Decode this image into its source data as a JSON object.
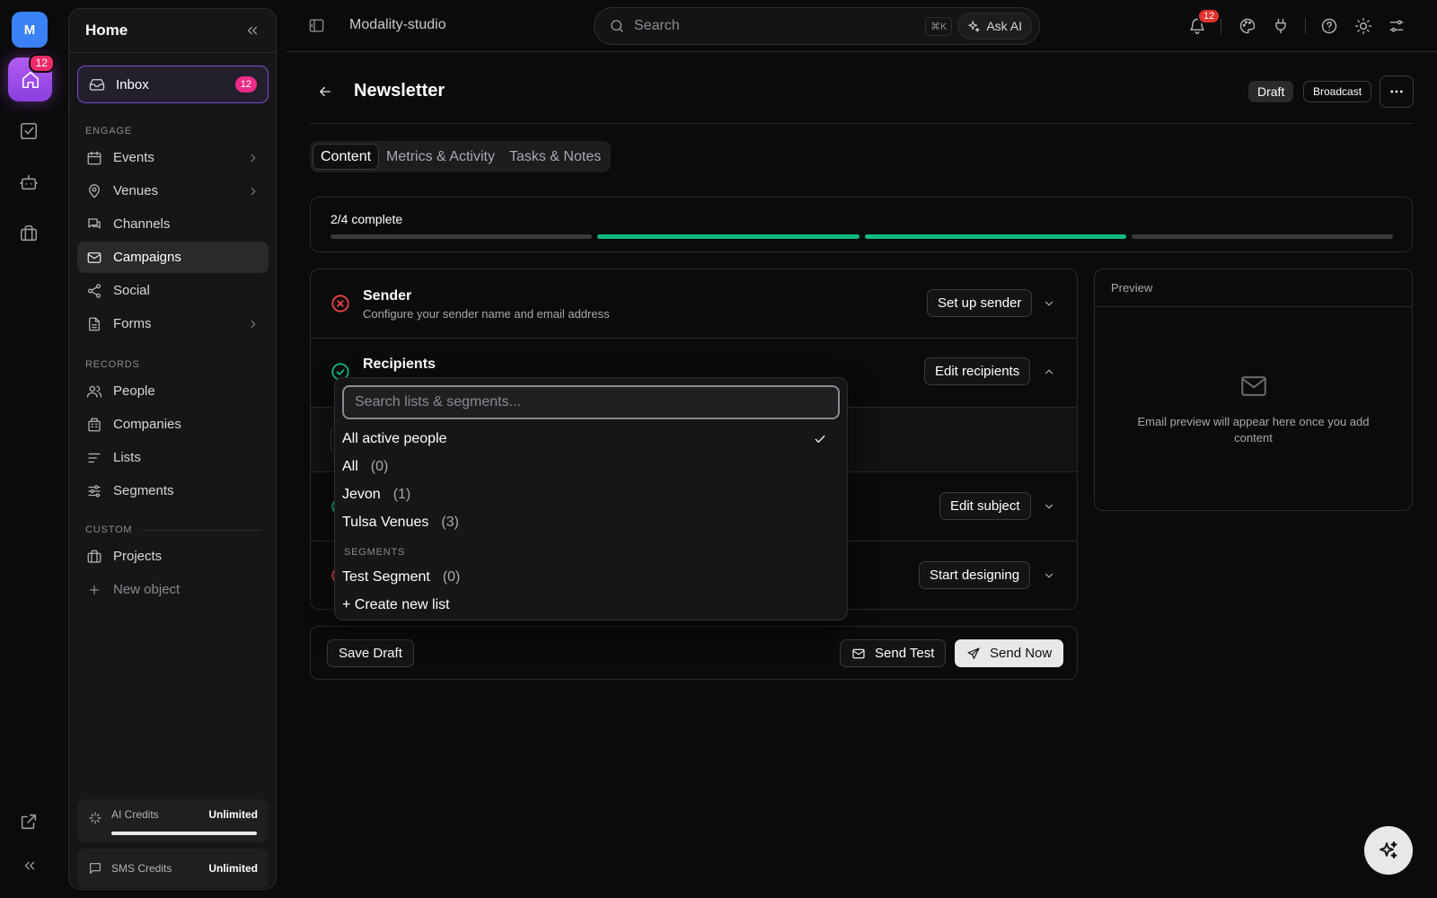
{
  "rail": {
    "workspace_initial": "M",
    "home_badge": "12"
  },
  "sidebar": {
    "title": "Home",
    "inbox": {
      "label": "Inbox",
      "badge": "12"
    },
    "sections": {
      "engage": "ENGAGE",
      "records": "RECORDS",
      "custom": "CUSTOM"
    },
    "engage_items": [
      {
        "label": "Events",
        "icon": "calendar-icon",
        "has_chevron": true
      },
      {
        "label": "Venues",
        "icon": "map-pin-icon",
        "has_chevron": true
      },
      {
        "label": "Channels",
        "icon": "chat-icon",
        "has_chevron": false
      },
      {
        "label": "Campaigns",
        "icon": "mail-icon",
        "has_chevron": false,
        "active": true
      },
      {
        "label": "Social",
        "icon": "share-icon",
        "has_chevron": false
      },
      {
        "label": "Forms",
        "icon": "file-icon",
        "has_chevron": true
      }
    ],
    "records_items": [
      {
        "label": "People",
        "icon": "users-icon"
      },
      {
        "label": "Companies",
        "icon": "building-icon"
      },
      {
        "label": "Lists",
        "icon": "list-icon"
      },
      {
        "label": "Segments",
        "icon": "sliders-icon"
      }
    ],
    "custom_items": [
      {
        "label": "Projects",
        "icon": "briefcase-icon"
      },
      {
        "label": "New object",
        "icon": "plus-icon"
      }
    ],
    "credits": [
      {
        "label": "AI Credits",
        "value": "Unlimited",
        "level": 1.0
      },
      {
        "label": "SMS Credits",
        "value": "Unlimited"
      }
    ]
  },
  "topbar": {
    "breadcrumb": "Modality-studio",
    "search_placeholder": "Search",
    "shortcut": "⌘K",
    "ask_ai": "Ask AI",
    "notification_count": "12"
  },
  "page": {
    "title": "Newsletter",
    "status": "Draft",
    "type": "Broadcast",
    "tabs": [
      "Content",
      "Metrics & Activity",
      "Tasks & Notes"
    ],
    "active_tab": 0,
    "progress": {
      "label": "2/4 complete",
      "segments": [
        false,
        true,
        true,
        false
      ]
    }
  },
  "steps": [
    {
      "title": "Sender",
      "desc": "Configure your sender name and email address",
      "status": "error",
      "button": "Set up sender",
      "expanded": false
    },
    {
      "title": "Recipients",
      "desc": "",
      "status": "done",
      "button": "Edit recipients",
      "expanded": true
    },
    {
      "title": "",
      "desc": "",
      "status": "done",
      "button": "Edit subject",
      "expanded": false
    },
    {
      "title": "",
      "desc": "",
      "status": "error",
      "button": "Start designing",
      "expanded": false
    }
  ],
  "footer": {
    "save_draft": "Save Draft",
    "send_test": "Send Test",
    "send_now": "Send Now"
  },
  "preview": {
    "header": "Preview",
    "empty_text": "Email preview will appear here once you add content"
  },
  "dropdown": {
    "placeholder": "Search lists & segments...",
    "options": [
      {
        "label": "All active people",
        "count": "",
        "selected": true
      },
      {
        "label": "All",
        "count": "(0)"
      },
      {
        "label": "Jevon",
        "count": "(1)"
      },
      {
        "label": "Tulsa Venues",
        "count": "(3)"
      }
    ],
    "segments_header": "SEGMENTS",
    "segment_options": [
      {
        "label": "Test Segment",
        "count": "(0)"
      }
    ],
    "create_new": "+ Create new list"
  },
  "colors": {
    "accent_purple": "#8a3fe0",
    "badge_pink": "#ec2c8a",
    "success_green": "#10b981",
    "error_red": "#ef4444"
  }
}
